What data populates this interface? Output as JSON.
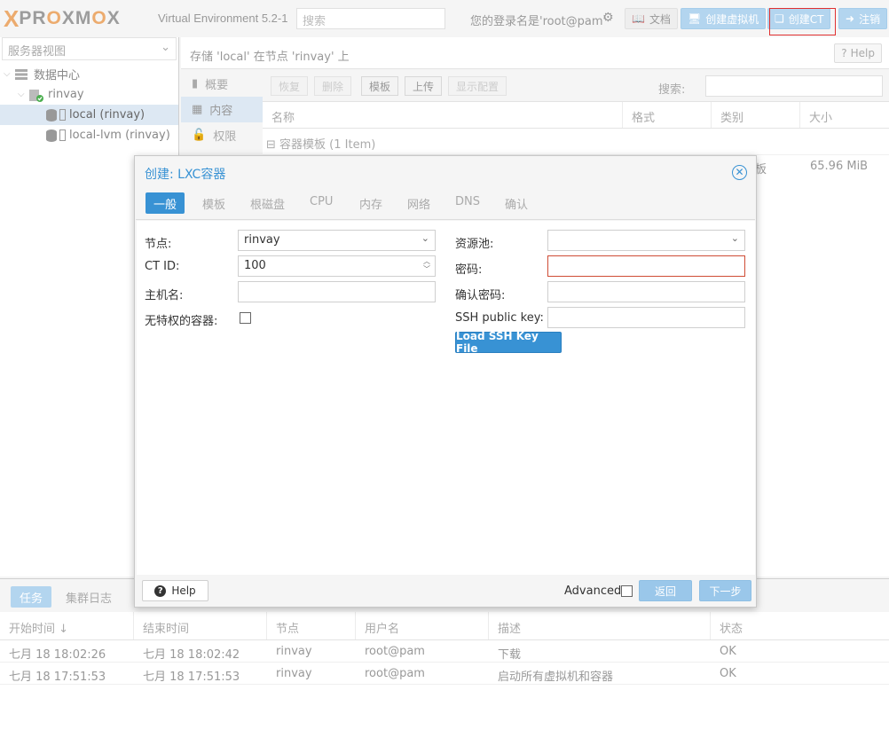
{
  "topbar": {
    "brand_x": "X",
    "brand_pr": "PR",
    "brand_o1": "O",
    "brand_xm": "XM",
    "brand_o2": "O",
    "brand_x2": "X",
    "version": "Virtual Environment 5.2-1",
    "search_placeholder": "搜索",
    "login_label": "您的登录名是'root@pam'",
    "docs_label": "文档",
    "create_vm_label": "创建虚拟机",
    "create_ct_label": "创建CT",
    "logout_label": "注销"
  },
  "tree": {
    "view_label": "服务器视图",
    "items": [
      {
        "label": "数据中心"
      },
      {
        "label": "rinvay"
      },
      {
        "label": "local (rinvay)"
      },
      {
        "label": "local-lvm (rinvay)"
      }
    ]
  },
  "content": {
    "title": "存储 'local' 在节点 'rinvay' 上",
    "help_label": "Help",
    "subnav": [
      {
        "label": "概要"
      },
      {
        "label": "内容"
      },
      {
        "label": "权限"
      }
    ],
    "toolbar": {
      "restore": "恢复",
      "remove": "删除",
      "templates": "模板",
      "upload": "上传",
      "show_config": "显示配置",
      "search_label": "搜索:"
    },
    "columns": [
      "名称",
      "格式",
      "类别",
      "大小"
    ],
    "group_label": "容器模板 (1 Item)",
    "row": {
      "type": "板",
      "size": "65.96 MiB"
    }
  },
  "dialog": {
    "title": "创建: LXC容器",
    "tabs": [
      "一般",
      "模板",
      "根磁盘",
      "CPU",
      "内存",
      "网络",
      "DNS",
      "确认"
    ],
    "fields": {
      "node_label": "节点:",
      "node_value": "rinvay",
      "ctid_label": "CT ID:",
      "ctid_value": "100",
      "hostname_label": "主机名:",
      "unprivileged_label": "无特权的容器:",
      "pool_label": "资源池:",
      "password_label": "密码:",
      "confirm_password_label": "确认密码:",
      "ssh_key_label": "SSH public key:"
    },
    "load_ssh_label": "Load SSH Key File",
    "footer": {
      "help_label": "Help",
      "advanced_label": "Advanced",
      "back_label": "返回",
      "next_label": "下一步"
    }
  },
  "tasks": {
    "tabs": [
      "任务",
      "集群日志"
    ],
    "columns": [
      "开始时间 ↓",
      "结束时间",
      "节点",
      "用户名",
      "描述",
      "状态"
    ],
    "rows": [
      {
        "start": "七月 18 18:02:26",
        "end": "七月 18 18:02:42",
        "node": "rinvay",
        "user": "root@pam",
        "desc": "下载",
        "status": "OK"
      },
      {
        "start": "七月 18 17:51:53",
        "end": "七月 18 17:51:53",
        "node": "rinvay",
        "user": "root@pam",
        "desc": "启动所有虚拟机和容器",
        "status": "OK"
      }
    ]
  },
  "colors": {
    "accent": "#3892d4",
    "brand_orange": "#e57000",
    "error_border": "#cf4c35",
    "highlight_box": "#e03030"
  }
}
